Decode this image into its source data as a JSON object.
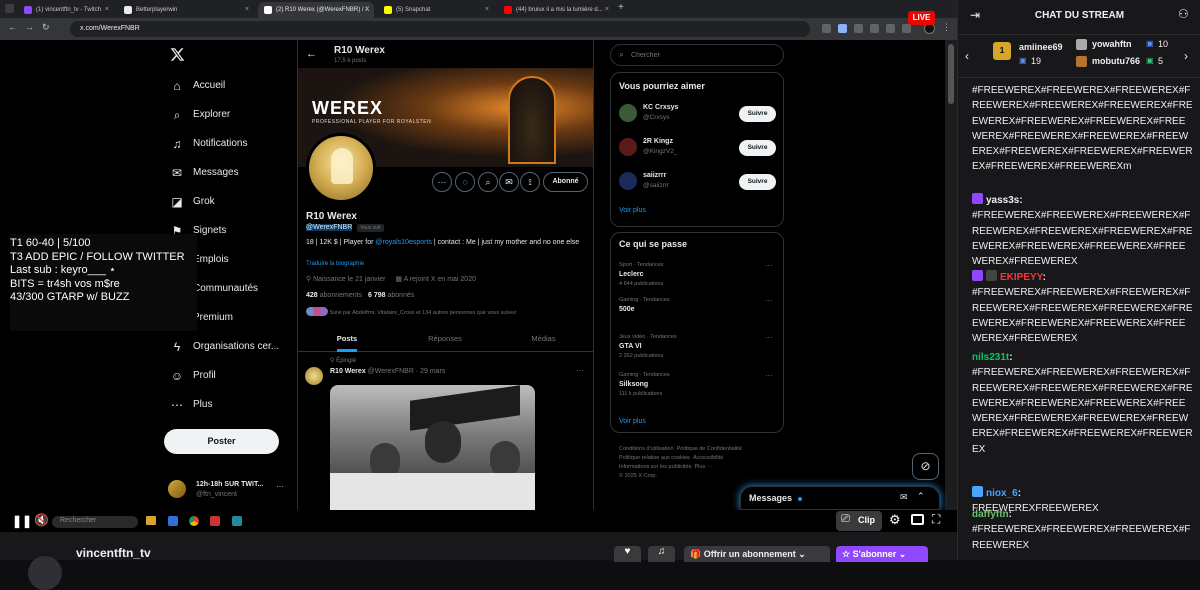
{
  "browser": {
    "tabs": [
      {
        "label": "(1) vincentftn_tv - Twitch",
        "color": "#9146ff"
      },
      {
        "label": "Betterplayerwin",
        "color": "#e8eaed"
      },
      {
        "label": "(2) R10 Werex (@WerexFNBR) / X",
        "color": "#ffffff"
      },
      {
        "label": "(5) Snapchat",
        "color": "#fffc00"
      },
      {
        "label": "(44) bruiux il a mis la lumière d...",
        "color": "#ff0000"
      }
    ],
    "new_tab": "+",
    "url": "x.com/WerexFNBR"
  },
  "x": {
    "nav": [
      {
        "label": "Accueil",
        "icon": "home-icon",
        "glyph": "⌂"
      },
      {
        "label": "Explorer",
        "icon": "search-icon",
        "glyph": "⌕"
      },
      {
        "label": "Notifications",
        "icon": "bell-icon",
        "glyph": "♫"
      },
      {
        "label": "Messages",
        "icon": "mail-icon",
        "glyph": "✉"
      },
      {
        "label": "Grok",
        "icon": "grok-icon",
        "glyph": "◪"
      },
      {
        "label": "Signets",
        "icon": "bookmark-icon",
        "glyph": "⚑"
      },
      {
        "label": "Emplois",
        "icon": "briefcase-icon",
        "glyph": "▣"
      },
      {
        "label": "Communautés",
        "icon": "people-icon",
        "glyph": "⚇"
      },
      {
        "label": "Premium",
        "icon": "x-premium-icon",
        "glyph": "✪"
      },
      {
        "label": "Organisations cer...",
        "icon": "lightning-icon",
        "glyph": "ϟ"
      },
      {
        "label": "Profil",
        "icon": "user-icon",
        "glyph": "☺"
      },
      {
        "label": "Plus",
        "icon": "more-circle-icon",
        "glyph": "⋯"
      }
    ],
    "post_button": "Poster",
    "account": {
      "name": "12h-18h SUR TWIT...",
      "handle": "@ftn_vincent"
    },
    "profile": {
      "header_name": "R10 Werex",
      "post_count": "17,5 k posts",
      "banner_title": "WEREX",
      "banner_subtitle": "PROFESSIONAL PLAYER FOR ROYALSTEN",
      "follow_state": "Abonné",
      "name": "R10 Werex",
      "handle": "@WerexFNBR",
      "follows_you": "Vous suit",
      "bio_part1": "18 | 12K $ | Player for ",
      "bio_mention": "@royals10esports",
      "bio_part2": " | contact : Me | just my mother and no one else",
      "translate": "Traduire la biographie",
      "birth": "Naissance le 21 janvier",
      "joined": "A rejoint X en mai 2020",
      "following_count": "428",
      "following_label": "abonnements",
      "followers_count": "6 798",
      "followers_label": "abonnés",
      "followed_by": "Suivi par Abdelfrnr, Vitalaire_Cross et 134 autres personnes que vous suivez",
      "tabs": [
        "Posts",
        "Réponses",
        "Médias"
      ]
    },
    "post": {
      "pinned": "Épinglé",
      "author": "R10 Werex",
      "meta": "@WerexFNBR · 29 mars",
      "more": "···"
    },
    "search_placeholder": "Chercher",
    "suggestions": {
      "title": "Vous pourriez aimer",
      "items": [
        {
          "name": "KC Crxsys",
          "handle": "@Crxsys",
          "button": "Suivre"
        },
        {
          "name": "2R Kingz",
          "handle": "@KingzV2_",
          "button": "Suivre"
        },
        {
          "name": "saiizrrr",
          "handle": "@saiizrrr",
          "button": "Suivre"
        }
      ],
      "more": "Voir plus"
    },
    "trends": {
      "title": "Ce qui se passe",
      "items": [
        {
          "cat": "Sport · Tendances",
          "name": "Leclerc",
          "count": "4 844 publications"
        },
        {
          "cat": "Gaming · Tendances",
          "name": "500e",
          "count": ""
        },
        {
          "cat": "Jeux vidéo · Tendances",
          "name": "GTA VI",
          "count": "2 262 publications"
        },
        {
          "cat": "Gaming · Tendances",
          "name": "Silksong",
          "count": "111 k publications"
        }
      ],
      "more": "Voir plus"
    },
    "footer": {
      "line1a": "Conditions d'utilisation",
      "line1b": "Politique de Confidentialité",
      "line2a": "Politique relative aux cookies",
      "line2b": "Accessibilité",
      "line3a": "Informations sur les publicités",
      "line3b": "Plus ···",
      "line4": "© 2025 X Corp."
    },
    "messages_drawer": "Messages"
  },
  "overlay": {
    "lines": [
      "T1 60-40  | 5/100",
      "T3 ADD EPIC / FOLLOW TWITTER",
      "Last sub : keyro___ ⋆",
      "BITS = tr4sh vos m$re",
      "43/300 GTARP w/ BUZZ"
    ]
  },
  "player": {
    "live_badge": "LIVE",
    "search_placeholder": "Rechercher",
    "clip": "Clip",
    "channel": "vincentftn_tv",
    "subscribe_offer": "Offrir un abonnement",
    "subscribe": "S'abonner"
  },
  "chat": {
    "title": "CHAT DU STREAM",
    "gifters": [
      {
        "name": "amiinee69",
        "count": "19"
      },
      {
        "name": "yowahftn",
        "count": "10"
      },
      {
        "name": "mobutu766",
        "count": "5"
      }
    ],
    "messages": [
      {
        "user": "",
        "color": "#efeff1",
        "text": "#FREEWEREX#FREEWEREX#FREEWEREX#FREEWEREX#FREEWEREX#FREEWEREX#FREEWEREX#FREEWEREX#FREEWEREX#FREEWEREX#FREEWEREX#FREEWEREX#FREEWEREX#FREEWEREX#FREEWEREX#FREEWEREX#FREEWEREX#FREEWEREXm"
      },
      {
        "user": "yass3s",
        "color": "#efeff1",
        "text": "#FREEWEREX#FREEWEREX#FREEWEREX#FREEWEREX#FREEWEREX#FREEWEREX#FREEWEREX#FREEWEREX#FREEWEREX#FREEWEREX#FREEWEREX"
      },
      {
        "user": "EKIPEYY",
        "color": "#ff3333",
        "text": "#FREEWEREX#FREEWEREX#FREEWEREX#FREEWEREX#FREEWEREX#FREEWEREX#FREEWEREX#FREEWEREX#FREEWEREX#FREEWEREX#FREEWEREX"
      },
      {
        "user": "nils231t",
        "color": "#00cc66",
        "text": "#FREEWEREX#FREEWEREX#FREEWEREX#FREEWEREX#FREEWEREX#FREEWEREX#FREEWEREX#FREEWEREX#FREEWEREX#FREEWEREX#FREEWEREX#FREEWEREX#FREEWEREX#FREEWEREX#FREEWEREX#FREEWEREX"
      },
      {
        "user": "niox_6",
        "color": "#4aa3ff",
        "text": "FREEWEREXFREEWEREX"
      },
      {
        "user": "daffyftn",
        "color": "#6dc06d",
        "text": "#FREEWEREX#FREEWEREX#FREEWEREX#FREEWEREX"
      }
    ]
  }
}
